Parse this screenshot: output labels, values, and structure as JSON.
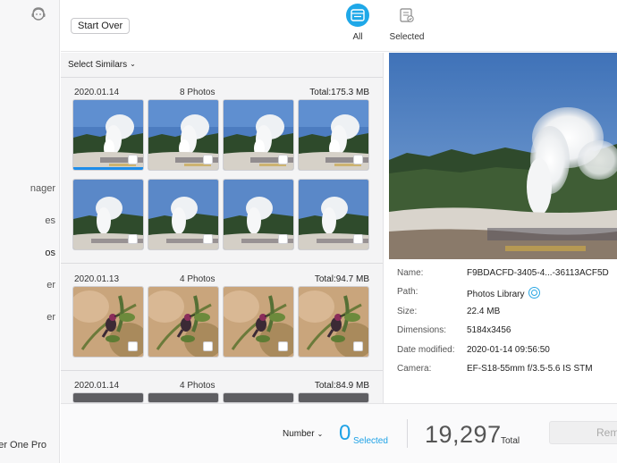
{
  "sidebar": {
    "items": [
      "nager",
      "es",
      "os",
      "er",
      "er"
    ],
    "product_name": "ner One Pro"
  },
  "toolbar": {
    "start_over": "Start Over",
    "tabs": [
      {
        "label": "All",
        "active": true
      },
      {
        "label": "Selected",
        "active": false
      }
    ]
  },
  "list": {
    "select_similars": "Select Similars",
    "groups": [
      {
        "date": "2020.01.14",
        "count": "8 Photos",
        "total": "Total:175.3 MB",
        "subject": "geyser",
        "thumbs": 8
      },
      {
        "date": "2020.01.13",
        "count": "4 Photos",
        "total": "Total:94.7 MB",
        "subject": "bird",
        "thumbs": 4
      },
      {
        "date": "2020.01.14",
        "count": "4 Photos",
        "total": "Total:84.9 MB",
        "subject": "grey",
        "thumbs": 4
      }
    ]
  },
  "details": {
    "rows": [
      {
        "key": "Name:",
        "value": "F9BDACFD-3405-4...-36113ACF5D"
      },
      {
        "key": "Path:",
        "value": "Photos Library"
      },
      {
        "key": "Size:",
        "value": "22.4 MB"
      },
      {
        "key": "Dimensions:",
        "value": "5184x3456"
      },
      {
        "key": "Date modified:",
        "value": "2020-01-14 09:56:50"
      },
      {
        "key": "Camera:",
        "value": "EF-S18-55mm f/3.5-5.6 IS STM"
      }
    ]
  },
  "bottom": {
    "sort_label": "Number",
    "selected_count": "0",
    "selected_label": "Selected",
    "total_count": "19,297",
    "total_label": "Total",
    "remove_label": "Rem"
  },
  "colors": {
    "accent": "#1fa8e8",
    "selection_bar": "#1e8de9"
  }
}
